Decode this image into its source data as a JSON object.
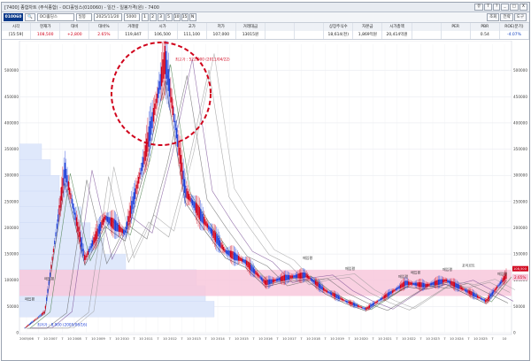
{
  "window": {
    "title": "[7400] 종합차트 (주식종합) - OCI홀딩스(010060) - 일간 - 일봉가격(원) - 7400",
    "buttons": [
      "유",
      "T",
      "?",
      "_",
      "□",
      "X"
    ]
  },
  "toolbar": {
    "code": "010060",
    "stock_name": "OCI홀딩스",
    "period_label": "일봉",
    "date": "2025/11/20",
    "count": "5000",
    "periods": [
      "1",
      "2",
      "3",
      "5",
      "10",
      "15",
      "N"
    ],
    "right_buttons": [
      "조회",
      "전략",
      "도구"
    ]
  },
  "quote": {
    "headers": [
      "시각",
      "현재가",
      "대비",
      "대비%",
      "거래량",
      "시가",
      "고가",
      "저가",
      "거래대금",
      "",
      "",
      "상장주식수",
      "자본금",
      "시가총액",
      "",
      "PER",
      "PBR",
      "ROE(분기)"
    ],
    "values": [
      "[15:59]",
      "108,500",
      "+2,800",
      "2.65%",
      "119,847",
      "106,500",
      "111,100",
      "107,000",
      "13015원",
      "",
      "",
      "18,614(천)",
      "1,869억원",
      "20,414억원",
      "",
      "",
      "0.54",
      "-4.07%"
    ]
  },
  "chart": {
    "y_ticks": [
      "0",
      "50000",
      "100000",
      "150000",
      "200000",
      "250000",
      "300000",
      "350000",
      "400000",
      "450000",
      "500000"
    ],
    "x_ticks": [
      "2005/06",
      "7",
      "10 2007",
      "7",
      "10 2008",
      "7",
      "10 2009",
      "7",
      "10 2010",
      "7",
      "10 2011",
      "7",
      "10 2012",
      "7",
      "10 2013",
      "7",
      "10 2014",
      "7",
      "10 2015",
      "7",
      "10 2016",
      "7",
      "10 2017",
      "7",
      "10 2018",
      "7",
      "10 2019",
      "7",
      "10 2020",
      "7",
      "10 2021",
      "7",
      "10 2022",
      "7",
      "10 2023",
      "7",
      "10 2024",
      "7",
      "10 2025",
      "7",
      "10"
    ],
    "annotations": {
      "high": "최고가 : 522,000 (2011/04/22)",
      "low": "최저가 : 8,900 (2005/06/16)",
      "buy_labels": [
        "매입평",
        "매입평",
        "매입평",
        "매입평",
        "매입평",
        "매입평",
        "매입평",
        "포이르트",
        "매입평"
      ],
      "right_badge": "2.65%",
      "right_price": "108,500"
    },
    "colors": {
      "candle_up": "#d0021b",
      "candle_down": "#1d3fd8",
      "band": "#f8c8dc",
      "volume_profile": "#dfe8fb",
      "highlight_circle": "#d0021b"
    }
  },
  "chart_data": {
    "type": "line",
    "title": "",
    "xlabel": "",
    "ylabel": "",
    "ylim": [
      0,
      550000
    ],
    "x": [
      "2005/06",
      "2007/07",
      "2008/06",
      "2008/10",
      "2009/05",
      "2010/03",
      "2010/11",
      "2011/04",
      "2011/09",
      "2012/06",
      "2013/06",
      "2014/06",
      "2015/06",
      "2016/06",
      "2017/06",
      "2018/06",
      "2019/06",
      "2020/03",
      "2020/12",
      "2021/06",
      "2022/06",
      "2023/06",
      "2024/06",
      "2025/04",
      "2025/11"
    ],
    "series": [
      {
        "values": [
          8900,
          40000,
          310000,
          140000,
          220000,
          190000,
          340000,
          522000,
          270000,
          210000,
          155000,
          135000,
          95000,
          105000,
          110000,
          80000,
          60000,
          45000,
          70000,
          95000,
          90000,
          100000,
          80000,
          60000,
          108500
        ]
      }
    ]
  }
}
